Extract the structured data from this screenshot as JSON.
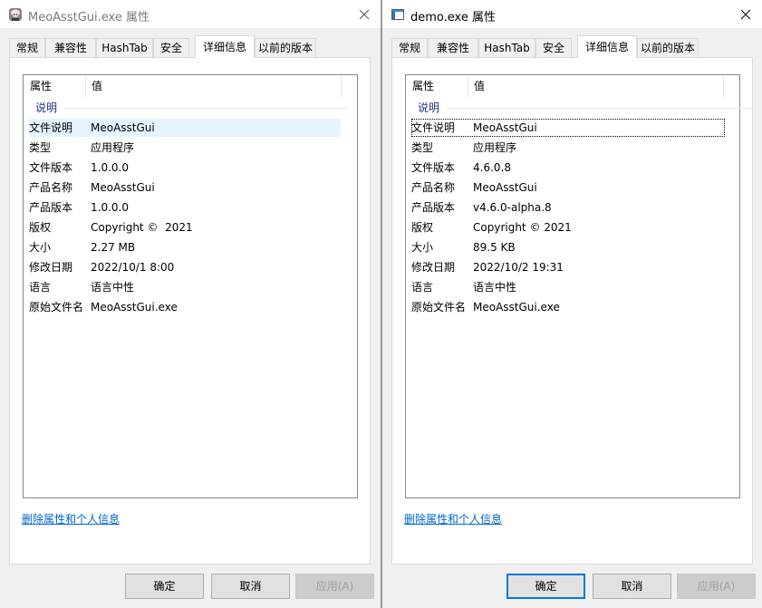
{
  "windows": [
    {
      "id": "left",
      "title": "MeoAsstGui.exe 属性",
      "tabs": [
        "常规",
        "兼容性",
        "HashTab",
        "安全",
        "详细信息",
        "以前的版本"
      ],
      "active_tab": "详细信息",
      "list": {
        "col_property": "属性",
        "col_value": "值",
        "group": "说明",
        "rows": [
          {
            "prop": "文件说明",
            "value": "MeoAsstGui"
          },
          {
            "prop": "类型",
            "value": "应用程序"
          },
          {
            "prop": "文件版本",
            "value": "1.0.0.0"
          },
          {
            "prop": "产品名称",
            "value": "MeoAsstGui"
          },
          {
            "prop": "产品版本",
            "value": "1.0.0.0"
          },
          {
            "prop": "版权",
            "value": "Copyright ©  2021"
          },
          {
            "prop": "大小",
            "value": "2.27 MB"
          },
          {
            "prop": "修改日期",
            "value": "2022/10/1 8:00"
          },
          {
            "prop": "语言",
            "value": "语言中性"
          },
          {
            "prop": "原始文件名",
            "value": "MeoAsstGui.exe"
          }
        ]
      },
      "remove_link": "删除属性和个人信息",
      "buttons": {
        "ok": "确定",
        "cancel": "取消",
        "apply": "应用(A)"
      }
    },
    {
      "id": "right",
      "title": "demo.exe 属性",
      "tabs": [
        "常规",
        "兼容性",
        "HashTab",
        "安全",
        "详细信息",
        "以前的版本"
      ],
      "active_tab": "详细信息",
      "list": {
        "col_property": "属性",
        "col_value": "值",
        "group": "说明",
        "rows": [
          {
            "prop": "文件说明",
            "value": "MeoAsstGui"
          },
          {
            "prop": "类型",
            "value": "应用程序"
          },
          {
            "prop": "文件版本",
            "value": "4.6.0.8"
          },
          {
            "prop": "产品名称",
            "value": "MeoAsstGui"
          },
          {
            "prop": "产品版本",
            "value": "v4.6.0-alpha.8"
          },
          {
            "prop": "版权",
            "value": "Copyright © 2021"
          },
          {
            "prop": "大小",
            "value": "89.5 KB"
          },
          {
            "prop": "修改日期",
            "value": "2022/10/2 19:31"
          },
          {
            "prop": "语言",
            "value": "语言中性"
          },
          {
            "prop": "原始文件名",
            "value": "MeoAsstGui.exe"
          }
        ]
      },
      "remove_link": "删除属性和个人信息",
      "buttons": {
        "ok": "确定",
        "cancel": "取消",
        "apply": "应用(A)"
      }
    }
  ],
  "colors": {
    "link": "#0066cc",
    "group_label": "#1e3287",
    "selection": "#e5f3ff",
    "default_button_border": "#0078d7"
  },
  "icons": {
    "left_app": "app-character-icon",
    "right_app": "app-window-icon",
    "close": "close-icon"
  }
}
